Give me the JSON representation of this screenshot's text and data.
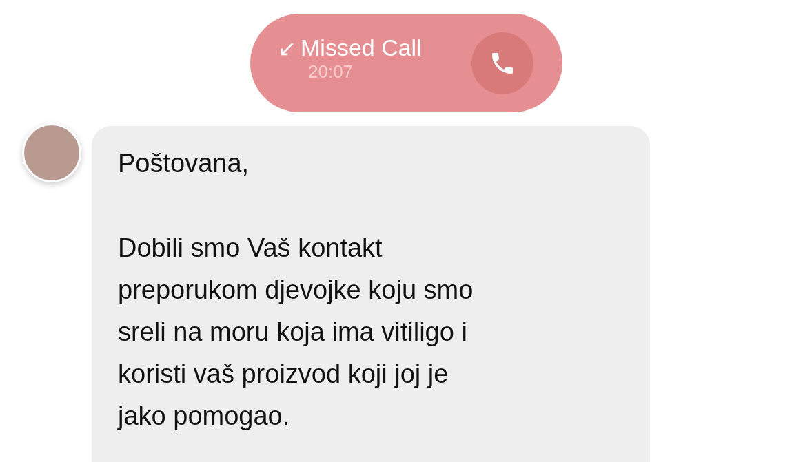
{
  "call_notice": {
    "arrow": "↙",
    "title": "Missed Call",
    "time": "20:07"
  },
  "message": {
    "paragraphs": [
      {
        "lines": [
          "Poštovana,"
        ]
      },
      {
        "lines": [
          "Dobili smo Vaš kontakt",
          "preporukom djevojke koju smo",
          "sreli na moru koja ima vitiligo i",
          "koristi vaš proizvod koji joj je",
          "jako pomogao."
        ]
      }
    ]
  }
}
